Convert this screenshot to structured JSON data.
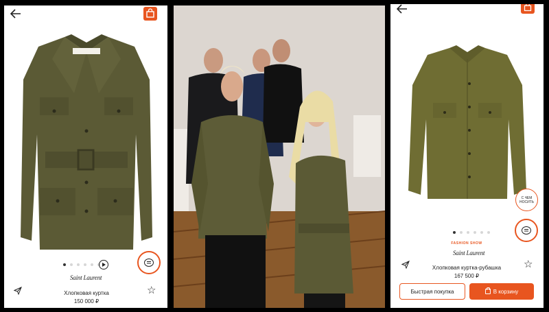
{
  "left_panel": {
    "product_name": "Хлопковая куртка",
    "price": "150 000 ₽",
    "brand": "Saint Laurent",
    "brand_sub": "",
    "carousel_dots": 6,
    "active_dot": 0
  },
  "right_panel": {
    "fashion_label": "FASHION SHOW",
    "product_name": "Хлопковая куртка-рубашка",
    "price": "167 500 ₽",
    "brand": "Saint Laurent",
    "how_to_wear_line1": "С ЧЕМ",
    "how_to_wear_line2": "НОСИТЬ",
    "quick_buy_label": "Быстрая покупка",
    "add_to_cart_label": "В корзину",
    "carousel_dots": 6,
    "active_dot": 0
  },
  "colors": {
    "accent": "#e8551f",
    "jacket_olive": "#5b5a35",
    "shirt_olive": "#6f6d33"
  },
  "icons": [
    "back-arrow-icon",
    "shopping-bag-icon",
    "play-icon",
    "chat-icon",
    "send-icon",
    "star-icon"
  ]
}
